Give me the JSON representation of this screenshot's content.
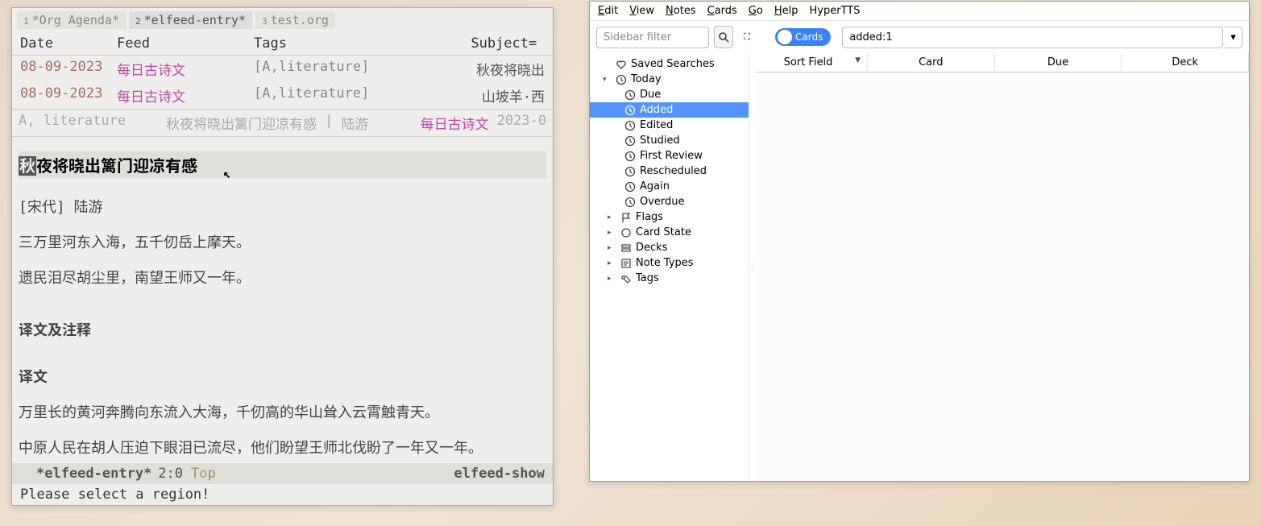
{
  "emacs": {
    "tabs": [
      {
        "num": "1",
        "label": "*Org Agenda*"
      },
      {
        "num": "2",
        "label": "*elfeed-entry*"
      },
      {
        "num": "3",
        "label": "test.org"
      }
    ],
    "columns": {
      "date": "Date",
      "feed": "Feed",
      "tags": "Tags",
      "subject": "Subject",
      "eq": "="
    },
    "rows": [
      {
        "date": "08-09-2023",
        "feed": "每日古诗文",
        "tags": "[A,literature]",
        "subject": "秋夜将晓出"
      },
      {
        "date": "08-09-2023",
        "feed": "每日古诗文",
        "tags": "[A,literature]",
        "subject": "山坡羊·西"
      }
    ],
    "meta": {
      "tags": "A, literature",
      "title": "秋夜将晓出篱门迎凉有感",
      "sep": "|",
      "author": "陆游",
      "feed": "每日古诗文",
      "date": "2023-0"
    },
    "entry": {
      "title_hi": "秋",
      "title_rest": "夜将晓出篱门迎凉有感",
      "p1": "[宋代] 陆游",
      "p2": "三万里河东入海，五千仞岳上摩天。",
      "p3": "遗民泪尽胡尘里，南望王师又一年。",
      "s1": "译文及注释",
      "s2": "译文",
      "p4": "万里长的黄河奔腾向东流入大海，千仞高的华山耸入云霄触青天。",
      "p5": "中原人民在胡人压迫下眼泪已流尽，他们盼望王师北伐盼了一年又一年。"
    },
    "modeline": {
      "name": "*elfeed-entry*",
      "coords": "2:0",
      "pos": "Top",
      "mode": "elfeed-show"
    },
    "minibuffer": "Please select a region!"
  },
  "anki": {
    "menu": [
      {
        "u": "E",
        "rest": "dit"
      },
      {
        "u": "V",
        "rest": "iew"
      },
      {
        "u": "N",
        "rest": "otes"
      },
      {
        "u": "C",
        "rest": "ards"
      },
      {
        "u": "G",
        "rest": "o"
      },
      {
        "u": "H",
        "rest": "elp"
      },
      {
        "u": "",
        "rest": "HyperTTS"
      }
    ],
    "sidebar_placeholder": "Sidebar filter",
    "toggle_label": "Cards",
    "query": "added:1",
    "tree": [
      {
        "depth": 0,
        "icon": "heart",
        "label": "Saved Searches",
        "arrow": ""
      },
      {
        "depth": 0,
        "icon": "clock",
        "label": "Today",
        "arrow": "▾"
      },
      {
        "depth": 2,
        "icon": "clock",
        "label": "Due",
        "arrow": ""
      },
      {
        "depth": 2,
        "icon": "clock",
        "label": "Added",
        "arrow": "",
        "selected": true
      },
      {
        "depth": 2,
        "icon": "clock",
        "label": "Edited",
        "arrow": ""
      },
      {
        "depth": 2,
        "icon": "clock",
        "label": "Studied",
        "arrow": ""
      },
      {
        "depth": 2,
        "icon": "clock",
        "label": "First Review",
        "arrow": ""
      },
      {
        "depth": 2,
        "icon": "clock",
        "label": "Rescheduled",
        "arrow": ""
      },
      {
        "depth": 2,
        "icon": "clock",
        "label": "Again",
        "arrow": ""
      },
      {
        "depth": 2,
        "icon": "clock",
        "label": "Overdue",
        "arrow": ""
      },
      {
        "depth": 1,
        "icon": "flag",
        "label": "Flags",
        "arrow": "▸"
      },
      {
        "depth": 1,
        "icon": "circle",
        "label": "Card State",
        "arrow": "▸"
      },
      {
        "depth": 1,
        "icon": "decks",
        "label": "Decks",
        "arrow": "▸"
      },
      {
        "depth": 1,
        "icon": "note",
        "label": "Note Types",
        "arrow": "▸"
      },
      {
        "depth": 1,
        "icon": "tag",
        "label": "Tags",
        "arrow": "▸"
      }
    ],
    "cols": {
      "sort": "Sort Field",
      "card": "Card",
      "due": "Due",
      "deck": "Deck"
    }
  }
}
